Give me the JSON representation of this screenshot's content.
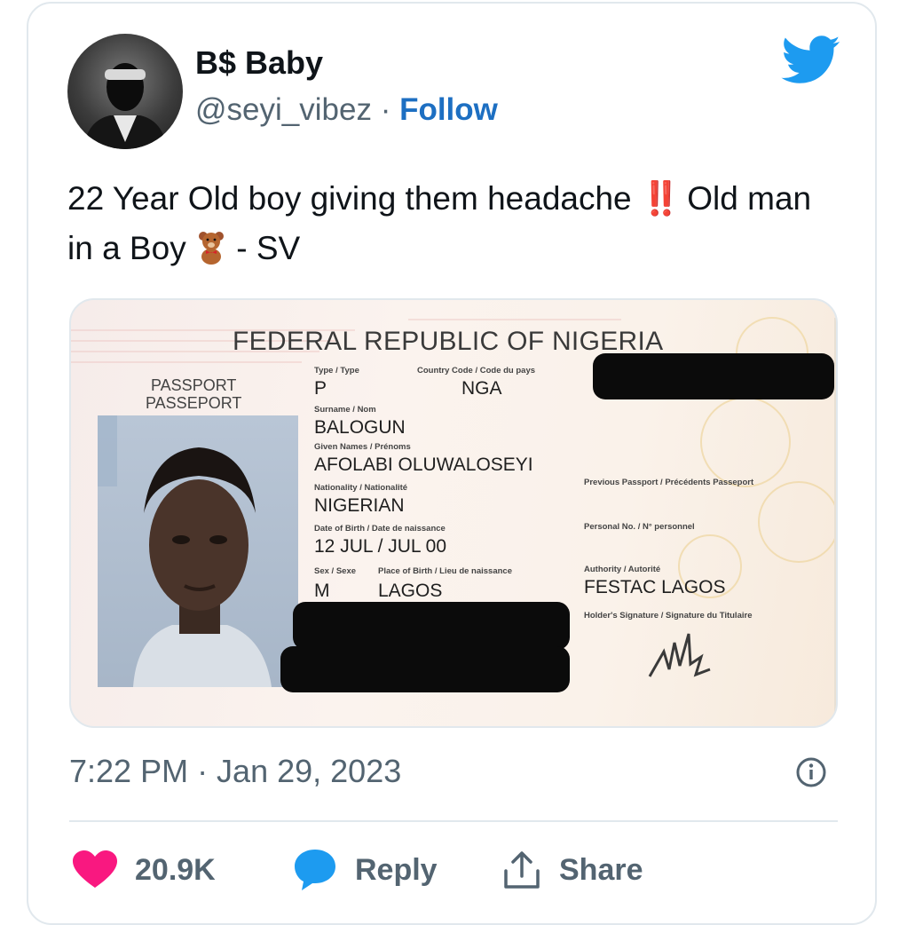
{
  "author": {
    "name": "B$ Baby",
    "handle": "@seyi_vibez",
    "separator": "·",
    "follow_label": "Follow"
  },
  "tweet": {
    "text_part1": "22 Year Old boy giving them headache ",
    "bang_emoji": "‼️",
    "text_part2": "Old man in a Boy ",
    "text_part3": " - SV"
  },
  "passport": {
    "country_title": "FEDERAL REPUBLIC OF NIGERIA",
    "doc_label_en": "PASSPORT",
    "doc_label_fr": "PASSEPORT",
    "type_label": "Type / Type",
    "type_value": "P",
    "country_code_label": "Country Code / Code du pays",
    "country_code_value": "NGA",
    "surname_label": "Surname / Nom",
    "surname_value": "BALOGUN",
    "given_names_label": "Given Names / Prénoms",
    "given_names_value": "AFOLABI OLUWALOSEYI",
    "nationality_label": "Nationality / Nationalité",
    "nationality_value": "NIGERIAN",
    "dob_label": "Date of Birth / Date de naissance",
    "dob_value": "12 JUL / JUL 00",
    "sex_label": "Sex / Sexe",
    "sex_value": "M",
    "pob_label": "Place of Birth / Lieu de naissance",
    "pob_value": "LAGOS",
    "prev_passport_label": "Previous Passport / Précédents Passeport",
    "personal_no_label": "Personal No. / N° personnel",
    "authority_label": "Authority / Autorité",
    "authority_value": "FESTAC LAGOS",
    "signature_label": "Holder's Signature / Signature du Titulaire"
  },
  "meta": {
    "timestamp": "7:22 PM · Jan 29, 2023"
  },
  "actions": {
    "like_count": "20.9K",
    "reply_label": "Reply",
    "share_label": "Share"
  },
  "colors": {
    "twitter_blue": "#1d9bf0",
    "follow_blue": "#1d6fc2",
    "like_pink": "#f91880",
    "muted_text": "#536471"
  }
}
